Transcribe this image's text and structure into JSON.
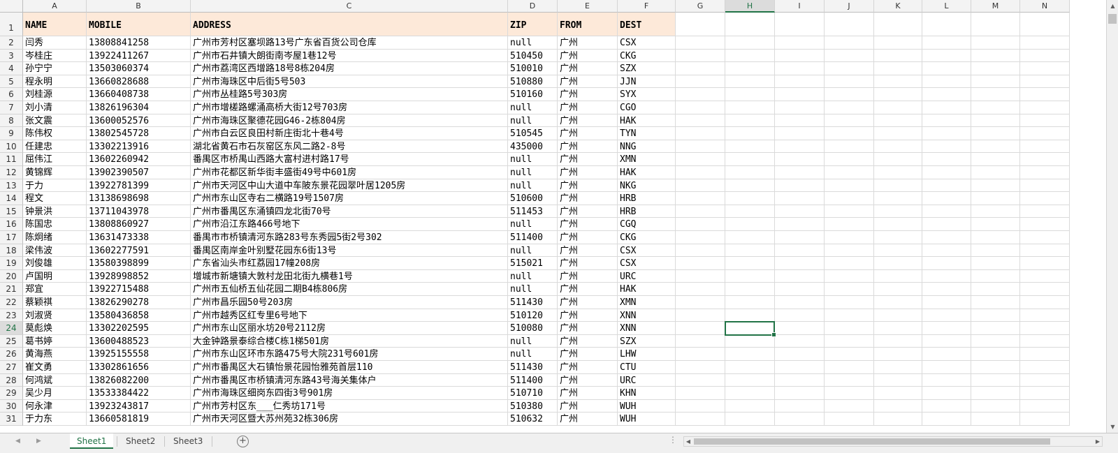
{
  "columns": [
    "A",
    "B",
    "C",
    "D",
    "E",
    "F",
    "G",
    "H",
    "I",
    "J",
    "K",
    "L",
    "M",
    "N"
  ],
  "selected_column": "H",
  "selected_row": 24,
  "headers": [
    "NAME",
    "MOBILE",
    "ADDRESS",
    "ZIP",
    "FROM",
    "DEST"
  ],
  "rows": [
    [
      "闫秀",
      "13808841258",
      "广州市芳村区塞坝路13号广东省百货公司仓库",
      "null",
      "广州",
      "CSX"
    ],
    [
      "岑桂庄",
      "13922411267",
      "广州市石井镇大朗街南岑屋1巷12号",
      "510450",
      "广州",
      "CKG"
    ],
    [
      "孙宁宁",
      "13503060374",
      "广州市荔湾区西增路18号8栋204房",
      "510010",
      "广州",
      "SZX"
    ],
    [
      "程永明",
      "13660828688",
      "广州市海珠区中后街5号503",
      "510880",
      "广州",
      "JJN"
    ],
    [
      "刘桂源",
      "13660408738",
      "广州市丛桂路5号303房",
      "510160",
      "广州",
      "SYX"
    ],
    [
      "刘小清",
      "13826196304",
      "广州市增槎路螺涌高桥大街12号703房",
      "null",
      "广州",
      "CGO"
    ],
    [
      "张文震",
      "13600052576",
      "广州市海珠区聚德花园G46-2栋804房",
      "null",
      "广州",
      "HAK"
    ],
    [
      "陈伟权",
      "13802545728",
      "广州市白云区良田村新庄街北十巷4号",
      "510545",
      "广州",
      "TYN"
    ],
    [
      "任建忠",
      "13302213916",
      "湖北省黄石市石灰窑区东风二路2-8号",
      "435000",
      "广州",
      "NNG"
    ],
    [
      "屈伟江",
      "13602260942",
      "番禺区市桥禺山西路大富村进村路17号",
      "null",
      "广州",
      "XMN"
    ],
    [
      "黄锦辉",
      "13902390507",
      "广州市花都区新华街丰盛街49号中601房",
      "null",
      "广州",
      "HAK"
    ],
    [
      "于力",
      "13922781399",
      "广州市天河区中山大道中车陂东景花园翠叶居1205房",
      "null",
      "广州",
      "NKG"
    ],
    [
      "程文",
      "13138698698",
      "广州市东山区寺右二横路19号1507房",
      "510600",
      "广州",
      "HRB"
    ],
    [
      "钟景洪",
      "13711043978",
      "广州市番禺区东涌镇四龙北街70号",
      "511453",
      "广州",
      "HRB"
    ],
    [
      "陈国忠",
      "13808860927",
      "广州市沿江东路466号地下",
      "null",
      "广州",
      "CGQ"
    ],
    [
      "陈炯绪",
      "13631473338",
      "番禺市市桥镇清河东路283号东秀园5街2号302",
      "511400",
      "广州",
      "CKG"
    ],
    [
      "梁伟波",
      "13602277591",
      "番禺区南岸金叶别墅花园东6街13号",
      "null",
      "广州",
      "CSX"
    ],
    [
      "刘俊雄",
      "13580398899",
      "广东省汕头市红荔园17幢208房",
      "515021",
      "广州",
      "CSX"
    ],
    [
      "卢国明",
      "13928998852",
      "增城市新塘镇大敦村龙田北街九横巷1号",
      "null",
      "广州",
      "URC"
    ],
    [
      "郑宜",
      "13922715488",
      "广州市五仙桥五仙花园二期B4栋806房",
      "null",
      "广州",
      "HAK"
    ],
    [
      "蔡颖祺",
      "13826290278",
      "广州市昌乐园50号203房",
      "511430",
      "广州",
      "XMN"
    ],
    [
      "刘淑贤",
      "13580436858",
      "广州市越秀区红专里6号地下",
      "510120",
      "广州",
      "XNN"
    ],
    [
      "莫彪焕",
      "13302202595",
      "广州市东山区丽水坊20号2112房",
      "510080",
      "广州",
      "XNN"
    ],
    [
      "葛书婷",
      "13600488523",
      "大金钟路景泰综合楼C栋1梯501房",
      "null",
      "广州",
      "SZX"
    ],
    [
      "黄海燕",
      "13925155558",
      "广州市东山区环市东路475号大院231号601房",
      "null",
      "广州",
      "LHW"
    ],
    [
      "崔文勇",
      "13302861656",
      "广州市番禺区大石镇怡景花园怡雅苑首层110",
      "511430",
      "广州",
      "CTU"
    ],
    [
      "何鸿斌",
      "13826082200",
      "广州市番禺区市桥镇清河东路43号海关集体户",
      "511400",
      "广州",
      "URC"
    ],
    [
      "吴少月",
      "13533384422",
      "广州市海珠区细岗东四街3号901房",
      "510710",
      "广州",
      "KHN"
    ],
    [
      "何永津",
      "13923243817",
      "广州市芳村区东___仁秀坊171号",
      "510380",
      "广州",
      "WUH"
    ],
    [
      "于力东",
      "13660581819",
      "广州市天河区暨大苏州苑32栋306房",
      "510632",
      "广州",
      "WUH"
    ]
  ],
  "sheet_tabs": [
    "Sheet1",
    "Sheet2",
    "Sheet3"
  ],
  "active_tab": "Sheet1",
  "icons": {
    "add_sheet": "plus-circle-icon",
    "scroll_up": "triangle-up-icon",
    "scroll_down": "triangle-down-icon",
    "scroll_left": "triangle-left-icon",
    "scroll_right": "triangle-right-icon",
    "tab_nav_prev": "chevron-left-icon",
    "tab_nav_next": "chevron-right-icon",
    "more_options": "vertical-dots-icon"
  },
  "colors": {
    "accent": "#217346",
    "header_fill": "#fde9d9"
  }
}
